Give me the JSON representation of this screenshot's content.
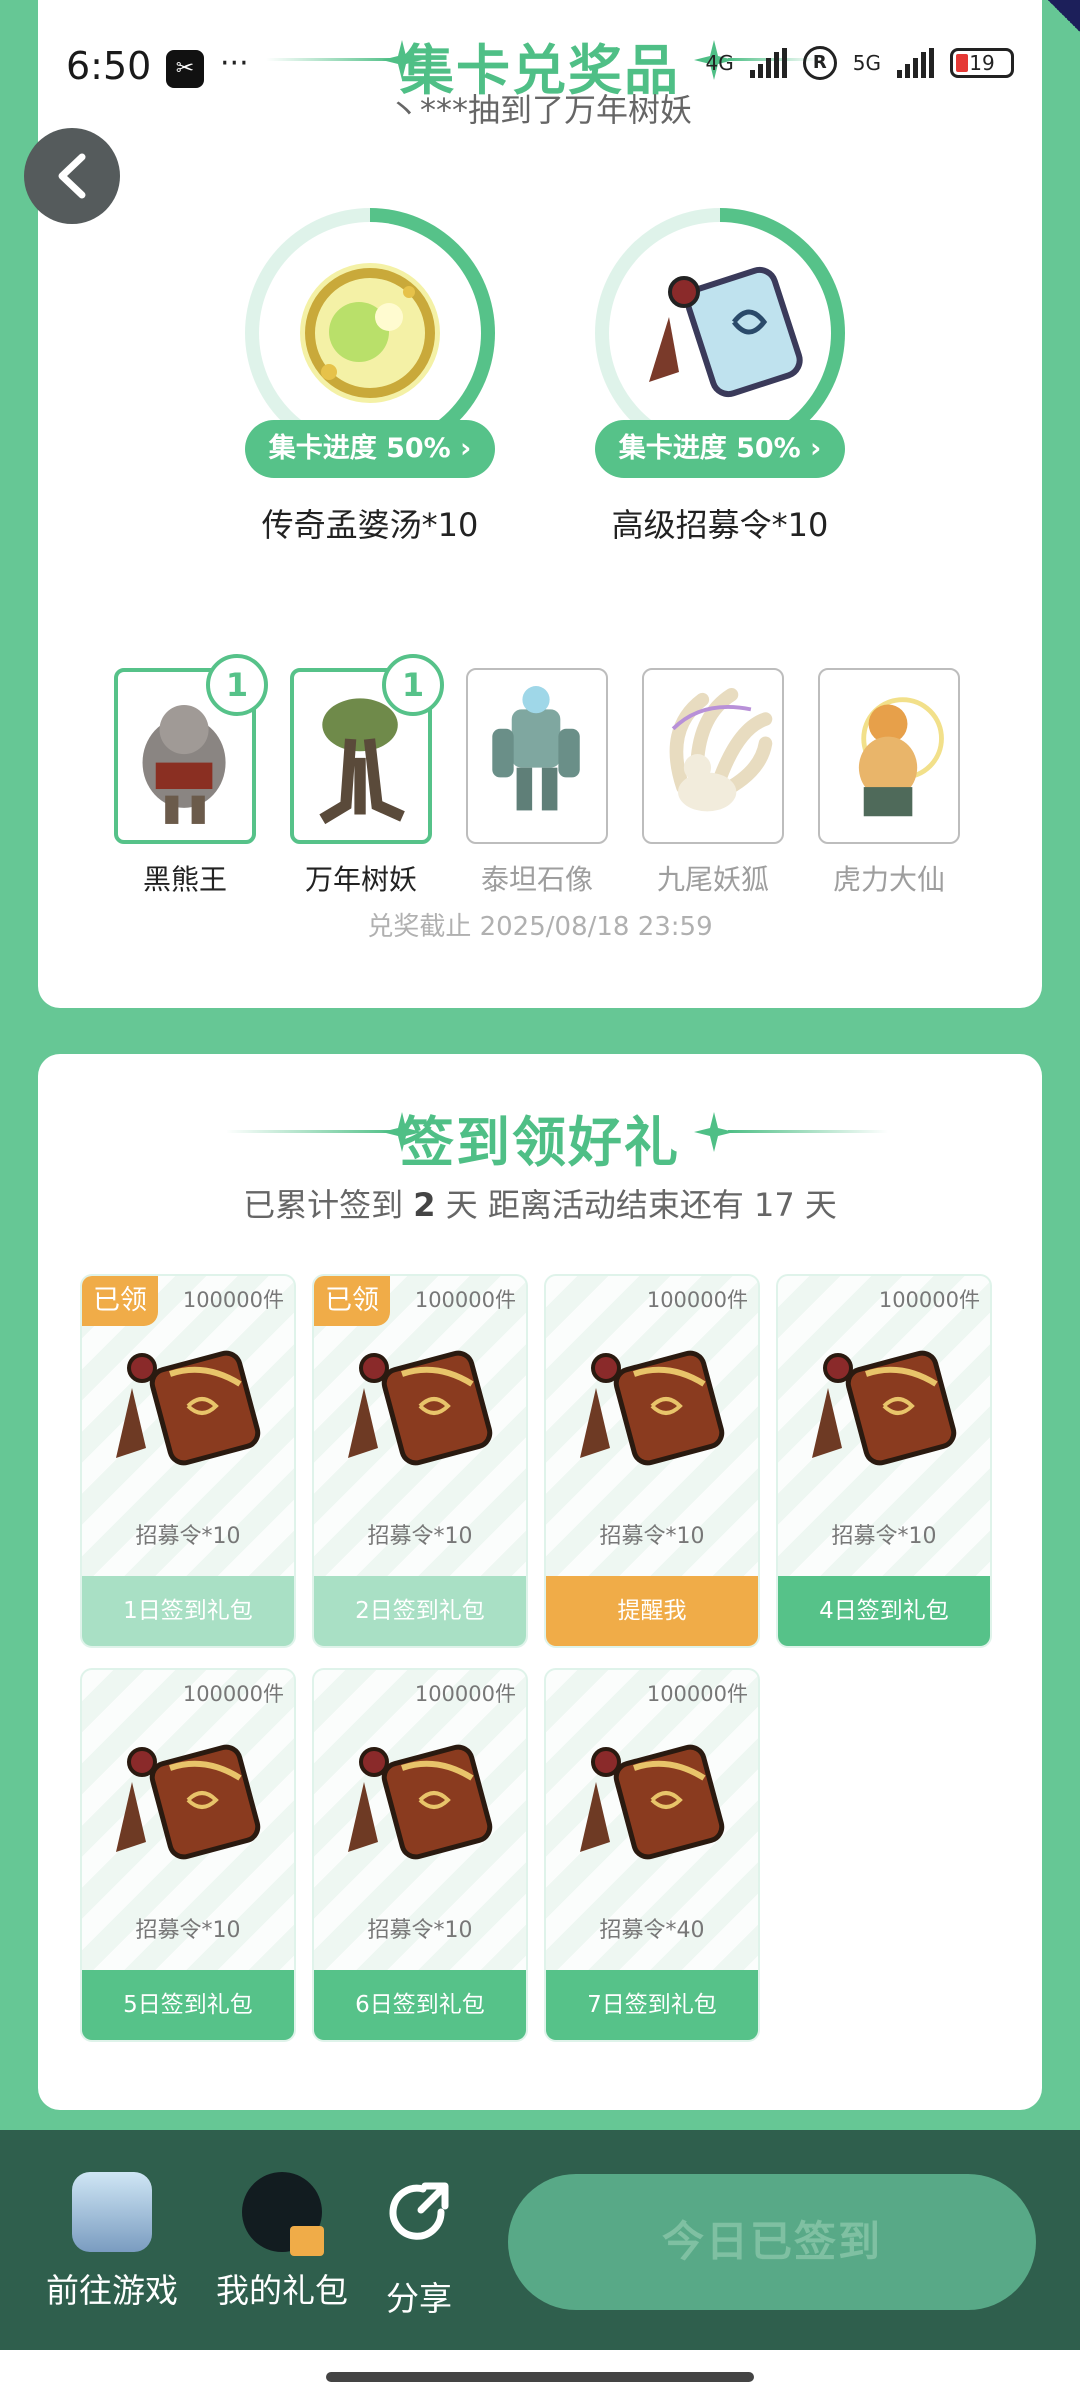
{
  "status_bar": {
    "time": "6:50",
    "app_icon": "capcut-icon",
    "dots": "···",
    "network1": "4G",
    "network2": "5G",
    "reg": "R",
    "battery": "19"
  },
  "prize_section": {
    "title": "集卡兑奖品",
    "winner_text": "丶***抽到了万年树妖",
    "prizes": [
      {
        "name": "传奇孟婆汤*10",
        "progress_label": "集卡进度 50%",
        "progress": 0.5,
        "icon": "potion-orb-icon"
      },
      {
        "name": "高级招募令*10",
        "progress_label": "集卡进度 50%",
        "progress": 0.5,
        "icon": "recruit-token-icon"
      }
    ],
    "monsters": [
      {
        "name": "黑熊王",
        "count": "1",
        "owned": true
      },
      {
        "name": "万年树妖",
        "count": "1",
        "owned": true
      },
      {
        "name": "泰坦石像",
        "owned": false
      },
      {
        "name": "九尾妖狐",
        "owned": false
      },
      {
        "name": "虎力大仙",
        "owned": false
      }
    ],
    "deadline": "兑奖截止 2025/08/18 23:59"
  },
  "sign_section": {
    "title": "签到领好礼",
    "sub_prefix": "已累计签到",
    "days_signed": "2",
    "sub_mid": "天  距离活动结束还有 17 天",
    "gifts": [
      {
        "stock": "100000件",
        "label": "招募令*10",
        "button": "1日签到礼包",
        "state": "claimed",
        "claimed_tag": "已领"
      },
      {
        "stock": "100000件",
        "label": "招募令*10",
        "button": "2日签到礼包",
        "state": "claimed",
        "claimed_tag": "已领"
      },
      {
        "stock": "100000件",
        "label": "招募令*10",
        "button": "提醒我",
        "state": "remind"
      },
      {
        "stock": "100000件",
        "label": "招募令*10",
        "button": "4日签到礼包",
        "state": "open"
      },
      {
        "stock": "100000件",
        "label": "招募令*10",
        "button": "5日签到礼包",
        "state": "open"
      },
      {
        "stock": "100000件",
        "label": "招募令*10",
        "button": "6日签到礼包",
        "state": "open"
      },
      {
        "stock": "100000件",
        "label": "招募令*40",
        "button": "7日签到礼包",
        "state": "open"
      }
    ]
  },
  "bottom_bar": {
    "go_game": "前往游戏",
    "my_gifts": "我的礼包",
    "share": "分享",
    "signed_today": "今日已签到"
  },
  "colors": {
    "accent": "#56c289",
    "background": "#66c795",
    "remind": "#f0ac48",
    "bottom_bar": "#2f5f4d"
  }
}
